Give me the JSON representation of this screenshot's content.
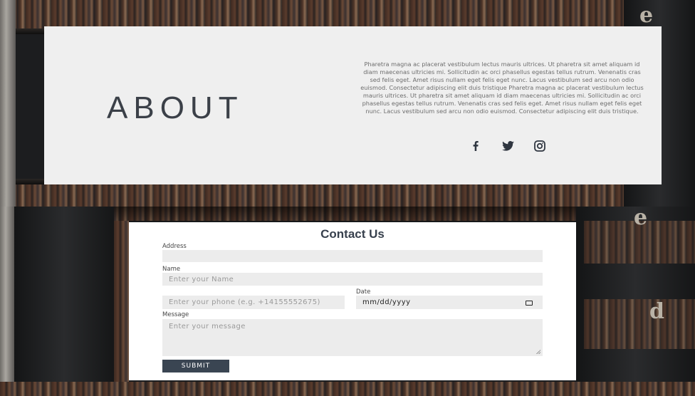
{
  "about": {
    "title": "ABOUT",
    "body": "Pharetra magna ac placerat vestibulum lectus mauris ultrices. Ut pharetra sit amet aliquam id diam maecenas ultricies mi. Sollicitudin ac orci phasellus egestas tellus rutrum. Venenatis cras sed felis eget. Amet risus nullam eget felis eget nunc. Lacus vestibulum sed arcu non odio euismod. Consectetur adipiscing elit duis tristique Pharetra magna ac placerat vestibulum lectus mauris ultrices. Ut pharetra sit amet aliquam id diam maecenas ultricies mi. Sollicitudin ac orci phasellus egestas tellus rutrum. Venenatis cras sed felis eget. Amet risus nullam eget felis eget nunc. Lacus vestibulum sed arcu non odio euismod. Consectetur adipiscing elit duis tristique.",
    "socials": [
      "facebook-icon",
      "twitter-icon",
      "instagram-icon"
    ]
  },
  "contact": {
    "title": "Contact Us",
    "address_label": "Address",
    "address_value": "",
    "name_label": "Name",
    "name_placeholder": "Enter your Name",
    "phone_placeholder": "Enter your phone (e.g. +14155552675)",
    "date_label": "Date",
    "date_placeholder": "mm/dd/yyyy",
    "message_label": "Message",
    "message_placeholder": "Enter your message",
    "submit_label": "SUBMIT"
  },
  "background": {
    "letters": [
      "e",
      "e",
      "d"
    ]
  },
  "colors": {
    "card_bg": "#efefef",
    "contact_bg": "#ffffff",
    "field_bg": "#ececec",
    "button_bg": "#3a4552",
    "heading": "#37404d"
  }
}
